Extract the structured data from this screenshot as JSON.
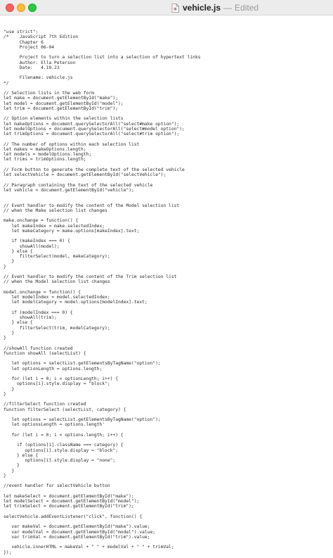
{
  "window": {
    "file_name": "vehicle.js",
    "separator": "—",
    "status": "Edited",
    "file_icon": "document-icon"
  },
  "editor": {
    "code": "\"use strict\";\n/*    JavaScript 7th Edition\n      Chapter 6\n      Project 06-04\n\n      Project to turn a selection list into a selection of hypertext links\n      Author: Ella Peterson\n      Date:   4.19.23\n\n      Filename: vehicle.js\n*/\n\n// Selection lists in the web form\nlet make = document.getElementById(\"make\");\nlet model = document.getElementById(\"model\");\nlet trim = document.getElementById(\"trim\");\n\n// Option elements within the selection lists\nlet makeOptions = document.querySelectorAll(\"select#make option\");\nlet modelOptions = document.querySelectorAll(\"select#model option\");\nlet trimOptions = document.querySelectorAll(\"select#trim option\");\n\n// The number of options within each selection list\nlet makes = makeOptions.length;\nlet models = modelOptions.length;\nlet trims = trimOptions.length;\n\n// Form button to generate the complete text of the selected vehicle\nlet selectVehicle = document.getElementById(\"selectVehicle\");\n\n// Paragraph containing the text of the selected vehicle\nlet vehicle = document.getElementById(\"vehicle\");\n\n\n// Event handler to modify the content of the Model selection list\n// when the Make selection list changes\n\nmake.onchange = function() {\n   let makeIndex = make.selectedIndex;\n   let makeCategory = make.options[makeIndex].text;\n\n   if (makeIndex === 0) {\n      showAll(model);\n   } else {\n      filterSelect(model, makeCategory);\n   }\n}\n\n// Event handler to modify the content of the Trim selection list\n// when the Model selection list changes\n\nmodel.onchange = function() {\n   let modelIndex = model.selectedIndex;\n   let modelCategory = model.options[modelIndex].text;\n\n   if (modelIndex === 0) {\n      showAll(trim);\n   } else {\n      filterSelect(trim, modelCategory);\n   }\n}\n\n//showAll function created\nfunction showAll (selectList) {\n\n   let options = selectList.getElementsByTagName(\"option\");\n   let optionLength = options.length;\n\n   for (let i = 0; i < optionLength; i++) {\n     options[i].style.display = \"block\";\n   }\n}\n\n//filterSelect function created\nfunction filterSelect (selectList, category) {\n\n   let options = selectList.getElementsByTagName(\"option\");\n   let optionsLength = options.length'\n\n   for (let i = 0; i < options.length; i++) {\n\n     if (options[i].className === category) {\n        options[i].style.display = \"block\";\n     } else {\n        options[i].style.display = \"none\";\n     }\n   }\n}\n\n//event handler for selectVehicle button\n\nlet makeSelect = document.getElementById(\"make\");\nlet modelSelect = document.getElementById(\"model\");\nlet trimSelect = document.getElementById(\"trim\");\n\nselectVehicle.addEventListener(\"click\", function() {\n\n   var makeVal = document.getElementById(\"make\").value;\n   var modelVal = document.getElementById(\"model\").value;\n   var trimVal = document.getElementById(\"trim\").value;\n\n   vehicle.innerHTML = makeVal + \" \" + modelVal + \" \" + trimVal;\n});"
  }
}
